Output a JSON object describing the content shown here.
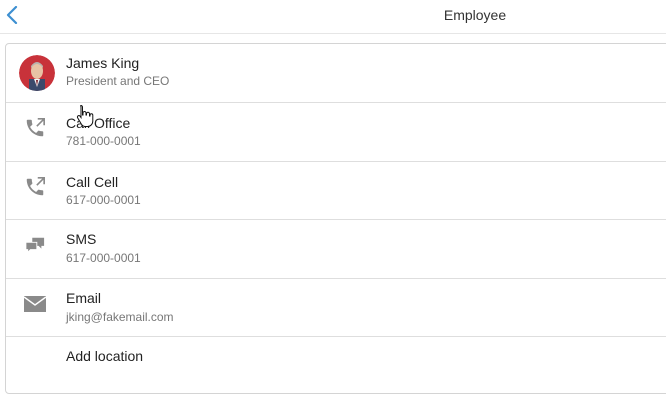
{
  "header": {
    "title": "Employee"
  },
  "employee": {
    "name": "James King",
    "position": "President and CEO"
  },
  "contacts": [
    {
      "label": "Call Office",
      "value": "781-000-0001",
      "icon": "phone-outgoing-icon"
    },
    {
      "label": "Call Cell",
      "value": "617-000-0001",
      "icon": "phone-outgoing-icon"
    },
    {
      "label": "SMS",
      "value": "617-000-0001",
      "icon": "chat-bubbles-icon"
    },
    {
      "label": "Email",
      "value": "jking@fakemail.com",
      "icon": "envelope-icon"
    }
  ],
  "location": {
    "label": "Add location"
  },
  "colors": {
    "accent": "#3d8fd1",
    "icon": "#8a8a8a",
    "divider": "#dedede"
  }
}
